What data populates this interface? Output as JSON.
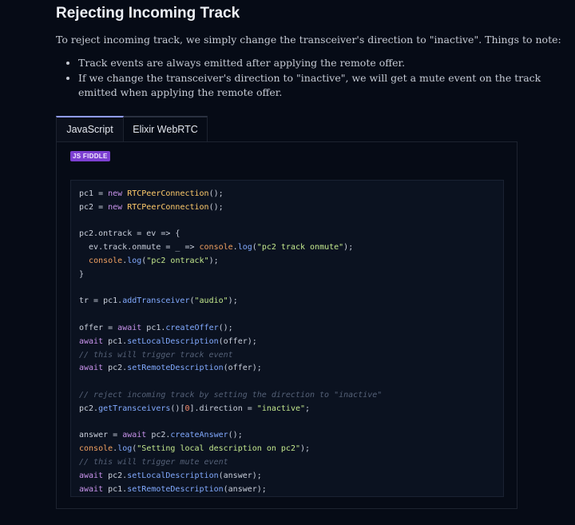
{
  "page": {
    "title": "Rejecting Incoming Track",
    "intro": "To reject incoming track, we simply change the transceiver's direction to \"inactive\". Things to note:",
    "notes": [
      "Track events are always emitted after applying the remote offer.",
      "If we change the transceiver's direction to \"inactive\", we will get a mute event on the track emitted when applying the remote offer."
    ]
  },
  "tabs": [
    {
      "label": "JavaScript",
      "active": true
    },
    {
      "label": "Elixir WebRTC",
      "active": false
    }
  ],
  "badge": {
    "label": "JS FIDDLE"
  },
  "code": {
    "language": "javascript",
    "lines": [
      [
        [
          "plain",
          "pc1 = "
        ],
        [
          "kw",
          "new "
        ],
        [
          "cls",
          "RTCPeerConnection"
        ],
        [
          "plain",
          "();"
        ]
      ],
      [
        [
          "plain",
          "pc2 = "
        ],
        [
          "kw",
          "new "
        ],
        [
          "cls",
          "RTCPeerConnection"
        ],
        [
          "plain",
          "();"
        ]
      ],
      [],
      [
        [
          "plain",
          "pc2.ontrack = ev => {"
        ]
      ],
      [
        [
          "plain",
          "  ev.track.onmute = _ => "
        ],
        [
          "ob",
          "console"
        ],
        [
          "plain",
          "."
        ],
        [
          "fn",
          "log"
        ],
        [
          "plain",
          "("
        ],
        [
          "str",
          "\"pc2 track onmute\""
        ],
        [
          "plain",
          ");"
        ]
      ],
      [
        [
          "plain",
          "  "
        ],
        [
          "ob",
          "console"
        ],
        [
          "plain",
          "."
        ],
        [
          "fn",
          "log"
        ],
        [
          "plain",
          "("
        ],
        [
          "str",
          "\"pc2 ontrack\""
        ],
        [
          "plain",
          ");"
        ]
      ],
      [
        [
          "plain",
          "}"
        ]
      ],
      [],
      [
        [
          "plain",
          "tr = pc1."
        ],
        [
          "fn",
          "addTransceiver"
        ],
        [
          "plain",
          "("
        ],
        [
          "str",
          "\"audio\""
        ],
        [
          "plain",
          ");"
        ]
      ],
      [],
      [
        [
          "plain",
          "offer = "
        ],
        [
          "kw",
          "await "
        ],
        [
          "plain",
          "pc1."
        ],
        [
          "fn",
          "createOffer"
        ],
        [
          "plain",
          "();"
        ]
      ],
      [
        [
          "kw",
          "await "
        ],
        [
          "plain",
          "pc1."
        ],
        [
          "fn",
          "setLocalDescription"
        ],
        [
          "plain",
          "(offer);"
        ]
      ],
      [
        [
          "cm",
          "// this will trigger track event"
        ]
      ],
      [
        [
          "kw",
          "await "
        ],
        [
          "plain",
          "pc2."
        ],
        [
          "fn",
          "setRemoteDescription"
        ],
        [
          "plain",
          "(offer);"
        ]
      ],
      [],
      [
        [
          "cm",
          "// reject incoming track by setting the direction to \"inactive\""
        ]
      ],
      [
        [
          "plain",
          "pc2."
        ],
        [
          "fn",
          "getTransceivers"
        ],
        [
          "plain",
          "()["
        ],
        [
          "num",
          "0"
        ],
        [
          "plain",
          "].direction = "
        ],
        [
          "str",
          "\"inactive\""
        ],
        [
          "plain",
          ";"
        ]
      ],
      [],
      [
        [
          "plain",
          "answer = "
        ],
        [
          "kw",
          "await "
        ],
        [
          "plain",
          "pc2."
        ],
        [
          "fn",
          "createAnswer"
        ],
        [
          "plain",
          "();"
        ]
      ],
      [
        [
          "ob",
          "console"
        ],
        [
          "plain",
          "."
        ],
        [
          "fn",
          "log"
        ],
        [
          "plain",
          "("
        ],
        [
          "str",
          "\"Setting local description on pc2\""
        ],
        [
          "plain",
          ");"
        ]
      ],
      [
        [
          "cm",
          "// this will trigger mute event"
        ]
      ],
      [
        [
          "kw",
          "await "
        ],
        [
          "plain",
          "pc2."
        ],
        [
          "fn",
          "setLocalDescription"
        ],
        [
          "plain",
          "(answer);"
        ]
      ],
      [
        [
          "kw",
          "await "
        ],
        [
          "plain",
          "pc1."
        ],
        [
          "fn",
          "setRemoteDescription"
        ],
        [
          "plain",
          "(answer);"
        ]
      ]
    ]
  }
}
